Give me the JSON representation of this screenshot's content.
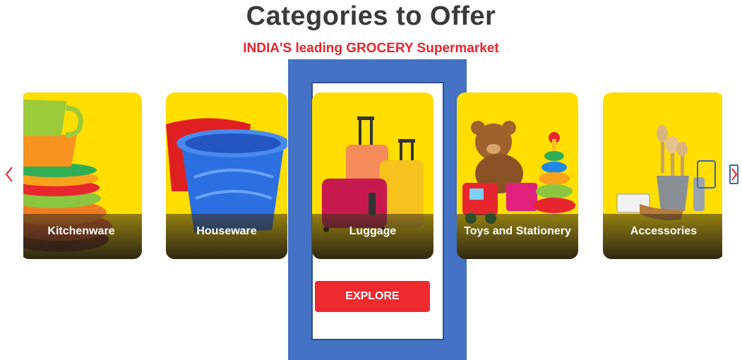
{
  "header": {
    "title": "Categories to Offer",
    "subtitle": "INDIA'S leading GROCERY Supermarket"
  },
  "carousel": {
    "prev_icon": "chevron-left-icon",
    "next_icon": "chevron-right-icon",
    "cards": [
      {
        "label": "Kitchenware"
      },
      {
        "label": "Houseware"
      },
      {
        "label": "Luggage"
      },
      {
        "label": "Toys and Stationery"
      },
      {
        "label": "Accessories"
      }
    ],
    "explore_label": "EXPLORE"
  },
  "colors": {
    "accent": "#e8262e",
    "card_background": "#ffde00",
    "highlight": "#4472c4"
  }
}
